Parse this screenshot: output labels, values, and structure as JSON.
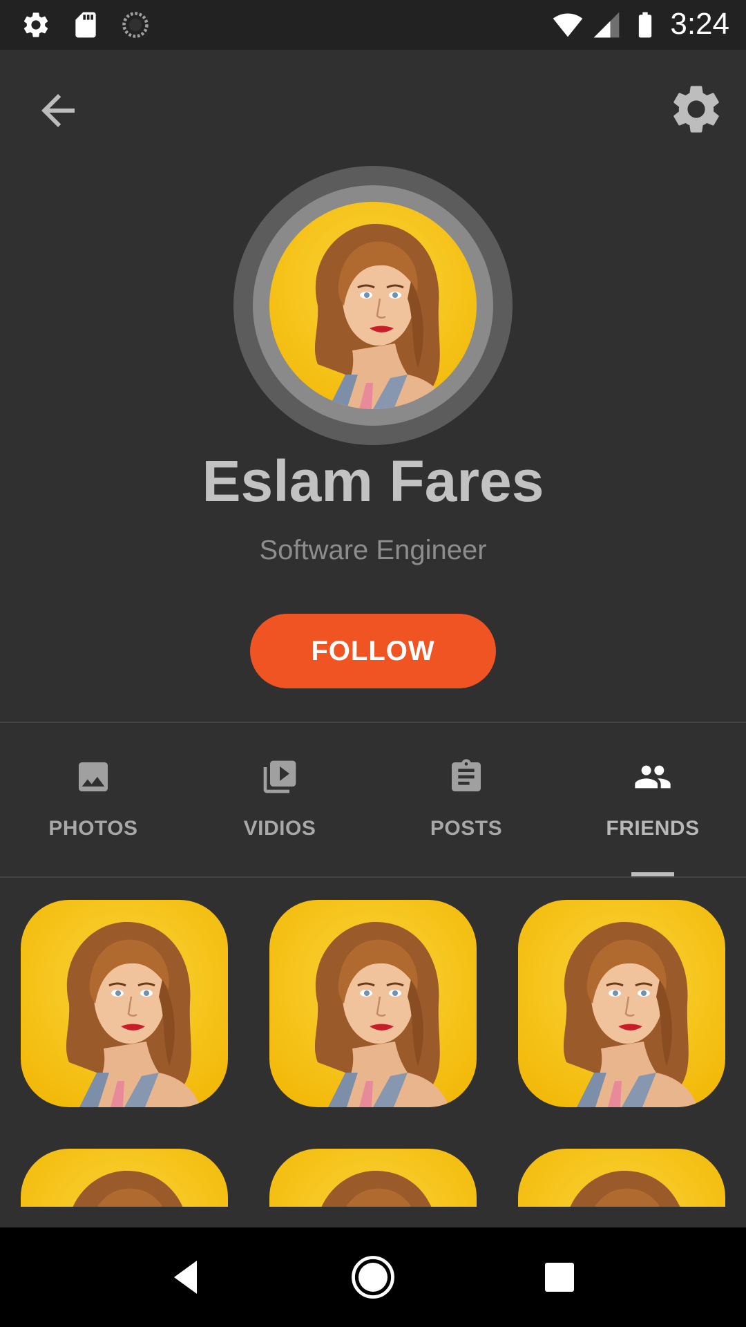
{
  "status_bar": {
    "time": "3:24",
    "icons": [
      "settings-icon",
      "sd-card-icon",
      "sync-icon",
      "wifi-icon",
      "signal-icon",
      "battery-icon"
    ]
  },
  "app_bar": {
    "back_icon": "arrow-back-icon",
    "settings_icon": "gear-icon"
  },
  "profile": {
    "name": "Eslam Fares",
    "title": "Software Engineer",
    "follow_label": "FOLLOW"
  },
  "tabs": [
    {
      "label": "PHOTOS",
      "icon": "image-icon",
      "active": false
    },
    {
      "label": "VIDIOS",
      "icon": "video-library-icon",
      "active": false
    },
    {
      "label": "POSTS",
      "icon": "clipboard-icon",
      "active": false
    },
    {
      "label": "FRIENDS",
      "icon": "people-icon",
      "active": true
    }
  ],
  "grid": {
    "rows": 2,
    "columns": 3
  },
  "colors": {
    "accent": "#f05423",
    "background": "#303030",
    "status_bar": "#222222",
    "photo_background": "#f7c51e"
  },
  "nav_bar": {
    "icons": [
      "nav-back-icon",
      "nav-home-icon",
      "nav-recents-icon"
    ]
  }
}
